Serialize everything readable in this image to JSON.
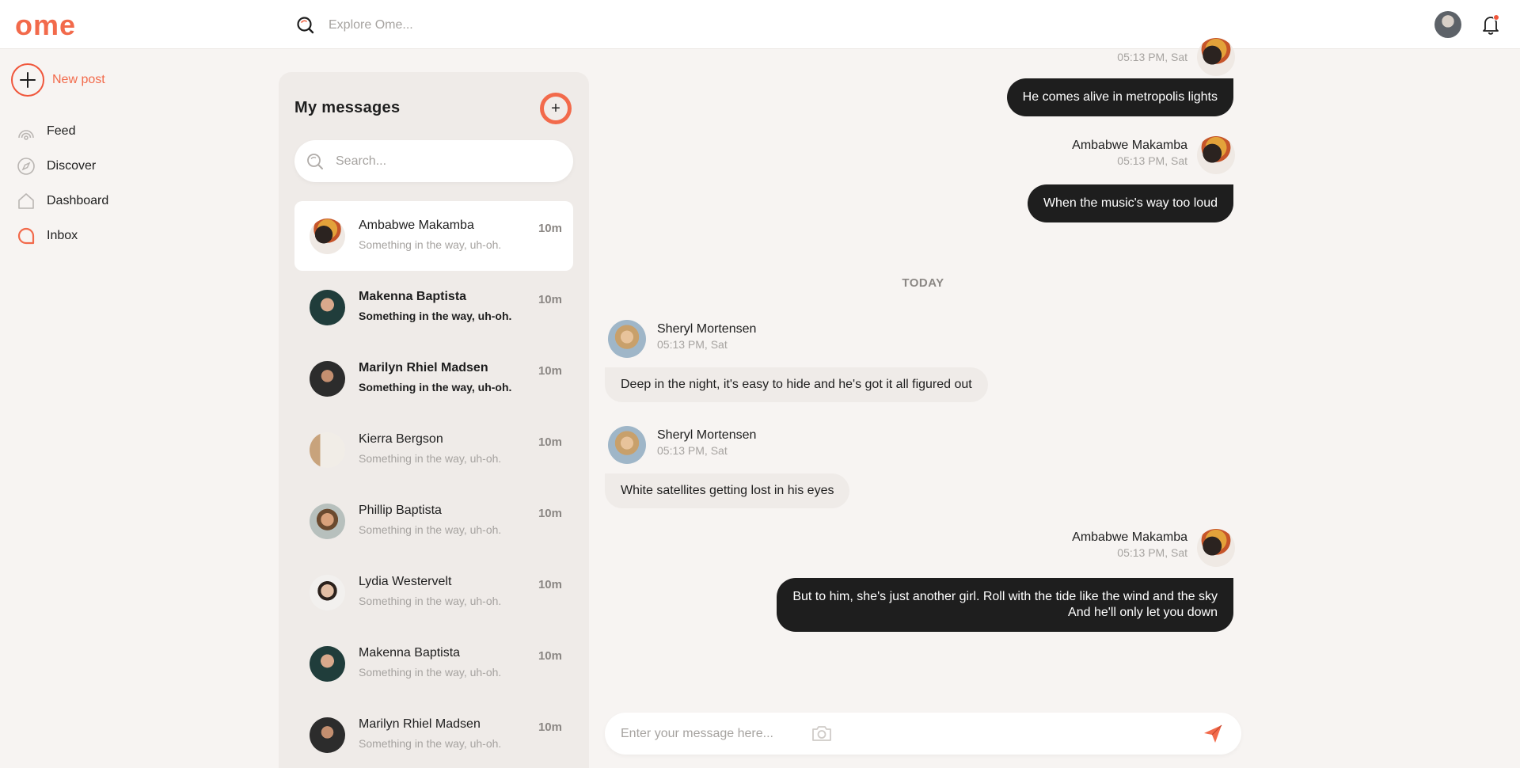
{
  "app": {
    "logo": "ome"
  },
  "topbar": {
    "search_placeholder": "Explore Ome..."
  },
  "sidebar": {
    "new_post_label": "New post",
    "items": [
      {
        "label": "Feed",
        "icon": "feed-icon"
      },
      {
        "label": "Discover",
        "icon": "compass-icon"
      },
      {
        "label": "Dashboard",
        "icon": "home-icon"
      },
      {
        "label": "Inbox",
        "icon": "inbox-icon"
      }
    ]
  },
  "messages_panel": {
    "title": "My messages",
    "search_placeholder": "Search...",
    "conversations": [
      {
        "name": "Ambabwe Makamba",
        "preview": "Something in the way, uh-oh.",
        "time": "10m",
        "state": "active"
      },
      {
        "name": "Makenna Baptista",
        "preview": "Something in the way, uh-oh.",
        "time": "10m",
        "state": "unread"
      },
      {
        "name": "Marilyn Rhiel Madsen",
        "preview": "Something in the way, uh-oh.",
        "time": "10m",
        "state": "unread"
      },
      {
        "name": "Kierra Bergson",
        "preview": "Something in the way, uh-oh.",
        "time": "10m",
        "state": "read"
      },
      {
        "name": "Phillip Baptista",
        "preview": "Something in the way, uh-oh.",
        "time": "10m",
        "state": "read"
      },
      {
        "name": "Lydia Westervelt",
        "preview": "Something in the way, uh-oh.",
        "time": "10m",
        "state": "read"
      },
      {
        "name": "Makenna Baptista",
        "preview": "Something in the way, uh-oh.",
        "time": "10m",
        "state": "read"
      },
      {
        "name": "Marilyn Rhiel Madsen",
        "preview": "Something in the way, uh-oh.",
        "time": "10m",
        "state": "read"
      }
    ]
  },
  "chat": {
    "day_separator": "TODAY",
    "messages": [
      {
        "sender": "",
        "time": "05:13 PM, Sat",
        "text": "He comes alive in metropolis lights",
        "outgoing": true
      },
      {
        "sender": "Ambabwe Makamba",
        "time": "05:13 PM, Sat",
        "text": "When the music's way too loud",
        "outgoing": true
      },
      {
        "sender": "Sheryl Mortensen",
        "time": "05:13 PM, Sat",
        "text": "Deep in the night, it's easy to hide and he's got it all figured out",
        "outgoing": false
      },
      {
        "sender": "Sheryl Mortensen",
        "time": "05:13 PM, Sat",
        "text": "White satellites getting lost in his eyes",
        "outgoing": false
      },
      {
        "sender": "Ambabwe Makamba",
        "time": "05:13 PM, Sat",
        "text_line1": "But to him, she's just another girl. Roll with the tide like the wind and the sky",
        "text_line2": "And he'll only let you down",
        "outgoing": true
      }
    ],
    "composer_placeholder": "Enter your message here..."
  },
  "colors": {
    "accent": "#f26a4b",
    "dark_bubble": "#1e1e1e",
    "light_bubble": "#efebe8",
    "background": "#f7f4f2"
  }
}
